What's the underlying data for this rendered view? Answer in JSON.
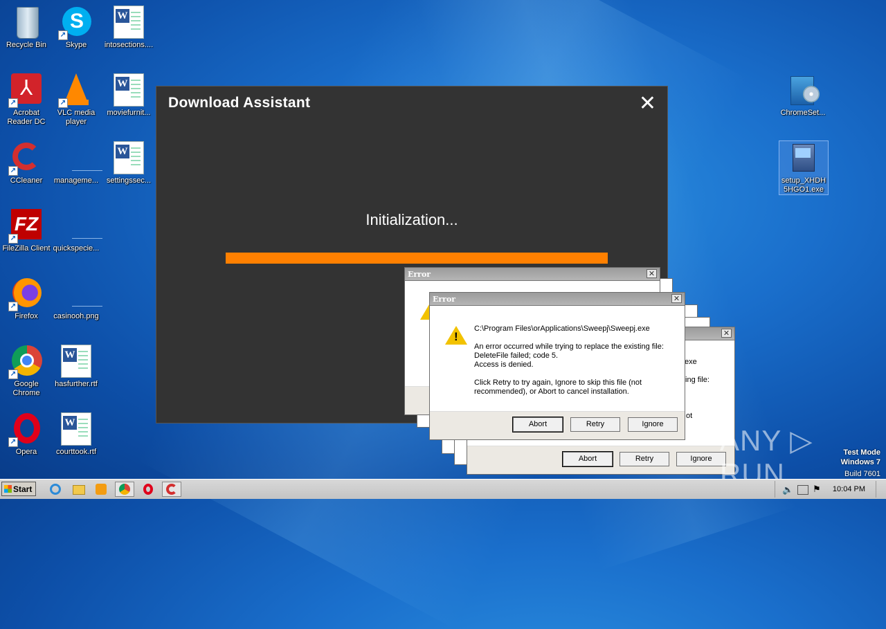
{
  "desktop": {
    "icons": [
      {
        "label": "Recycle Bin"
      },
      {
        "label": "Skype"
      },
      {
        "label": "intosections...."
      },
      {
        "label": "Acrobat Reader DC"
      },
      {
        "label": "VLC media player"
      },
      {
        "label": "moviefurnit..."
      },
      {
        "label": "CCleaner"
      },
      {
        "label": "manageme..."
      },
      {
        "label": "settingssec..."
      },
      {
        "label": "FileZilla Client"
      },
      {
        "label": "quickspecie..."
      },
      {
        "label": "Firefox"
      },
      {
        "label": "casinooh.png"
      },
      {
        "label": "Google Chrome"
      },
      {
        "label": "hasfurther.rtf"
      },
      {
        "label": "Opera"
      },
      {
        "label": "courttook.rtf"
      },
      {
        "label": "ChromeSet..."
      },
      {
        "label": "setup_XHDH5HGO1.exe"
      }
    ]
  },
  "download_assistant": {
    "title": "Download Assistant",
    "close_glyph": "✕",
    "status": "Initialization...",
    "progress": 1.0,
    "progress_color": "#ff8000"
  },
  "error_dialog": {
    "title": "Error",
    "close_glyph": "✕",
    "path": "C:\\Program Files\\orApplications\\Sweepj\\Sweepj.exe",
    "message": "An error occurred while trying to replace the existing file:\nDeleteFile failed; code 5.\nAccess is denied.",
    "hint": "Click Retry to try again, Ignore to skip this file (not recommended), or Abort to cancel installation.",
    "buttons": {
      "abort": "Abort",
      "retry": "Retry",
      "ignore": "Ignore"
    }
  },
  "back_dialog": {
    "fragment_exe": "exe",
    "fragment_file": "ting file:",
    "fragment_ot": "ot"
  },
  "taskbar": {
    "start_label": "Start",
    "clock": "10:04 PM"
  },
  "watermark": {
    "line1": "Test Mode",
    "line2": "Windows 7",
    "line3": "Build 7601",
    "brand": "ANY ▷ RUN"
  }
}
